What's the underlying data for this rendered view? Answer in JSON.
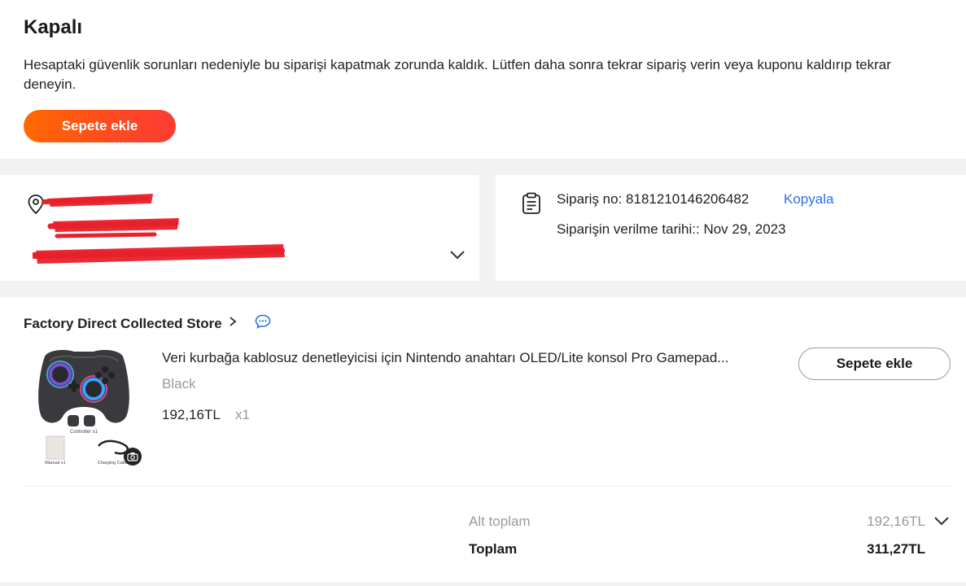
{
  "status": {
    "title": "Kapalı",
    "message": "Hesaptaki güvenlik sorunları nedeniyle bu siparişi kapatmak zorunda kaldık. Lütfen daha sonra tekrar sipariş verin veya kuponu kaldırıp tekrar deneyin.",
    "button_label": "Sepete ekle"
  },
  "address": {
    "icon": "location-pin-icon",
    "expand_icon": "chevron-down-icon"
  },
  "order": {
    "icon": "clipboard-icon",
    "number_label": "Sipariş no: 8181210146206482",
    "copy_label": "Kopyala",
    "date_label": "Siparişin verilme tarihi:: Nov 29, 2023"
  },
  "store": {
    "name": "Factory Direct Collected Store",
    "chat_icon": "chat-bubble-icon"
  },
  "product": {
    "title": "Veri kurbağa kablosuz denetleyicisi için Nintendo anahtarı OLED/Lite konsol Pro Gamepad...",
    "variant": "Black",
    "price": "192,16TL",
    "quantity": "x1",
    "button_label": "Sepete ekle",
    "image_captions": {
      "controller": "Controller x1",
      "manual": "Manual x1",
      "cable": "Charging Cable"
    }
  },
  "summary": {
    "subtotal_label": "Alt toplam",
    "subtotal_value": "192,16TL",
    "total_label": "Toplam",
    "total_value": "311,27TL"
  },
  "colors": {
    "accent_start": "#ff6a00",
    "accent_end": "#fb3b33",
    "link": "#2e6fe8",
    "redaction": "#e8202a"
  }
}
